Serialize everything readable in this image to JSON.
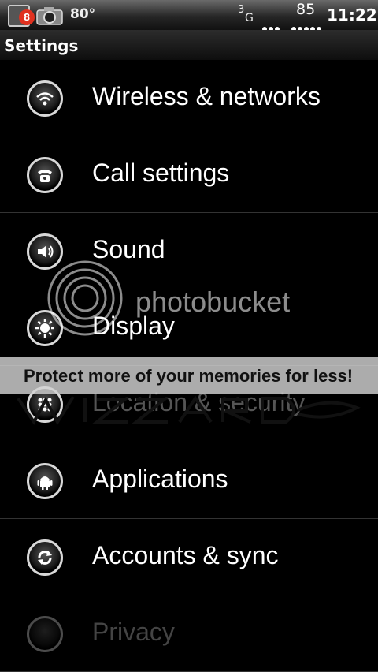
{
  "status_bar": {
    "notification_count": "8",
    "temperature": "80°",
    "network_type_superscript": "3",
    "network_type": "G",
    "battery_level": "85",
    "time": "11:22"
  },
  "title": "Settings",
  "items": [
    {
      "label": "Wireless & networks",
      "icon": "wifi-icon"
    },
    {
      "label": "Call settings",
      "icon": "phone-icon"
    },
    {
      "label": "Sound",
      "icon": "speaker-icon"
    },
    {
      "label": "Display",
      "icon": "display-icon"
    },
    {
      "label": "Location & security",
      "icon": "location-icon"
    },
    {
      "label": "Applications",
      "icon": "android-icon"
    },
    {
      "label": "Accounts & sync",
      "icon": "sync-icon"
    },
    {
      "label": "Privacy",
      "icon": "privacy-icon"
    }
  ],
  "watermark": {
    "brand": "photobucket",
    "banner": "Protect more of your memories for less!",
    "signature": "WIZZARD"
  }
}
